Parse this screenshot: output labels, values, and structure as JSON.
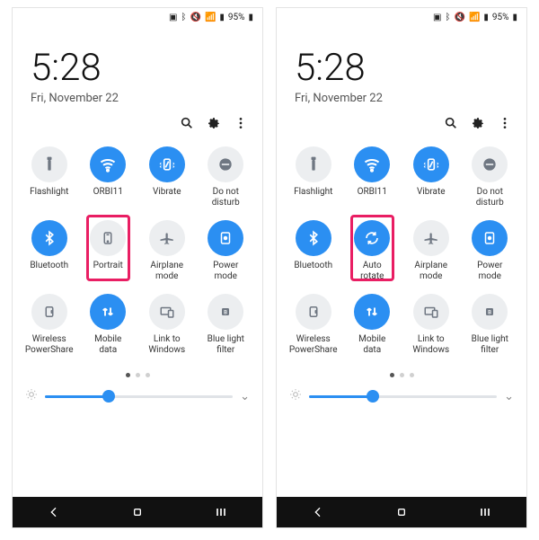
{
  "status": {
    "battery_pct": "95%"
  },
  "clock": {
    "time": "5:28",
    "date": "Fri, November 22"
  },
  "brightness": {
    "value": 34
  },
  "phones": [
    {
      "rotation_tile": {
        "label": "Portrait",
        "on": false,
        "icon": "portrait-icon"
      }
    },
    {
      "rotation_tile": {
        "label": "Auto\nrotate",
        "on": true,
        "icon": "rotate-icon"
      }
    }
  ],
  "tiles": {
    "flashlight": "Flashlight",
    "wifi": "ORBI11",
    "vibrate": "Vibrate",
    "dnd": "Do not\ndisturb",
    "bluetooth": "Bluetooth",
    "airplane": "Airplane\nmode",
    "power": "Power\nmode",
    "powershare": "Wireless\nPowerShare",
    "mobiledata": "Mobile\ndata",
    "linkwin": "Link to\nWindows",
    "bluelight": "Blue light\nfilter"
  }
}
